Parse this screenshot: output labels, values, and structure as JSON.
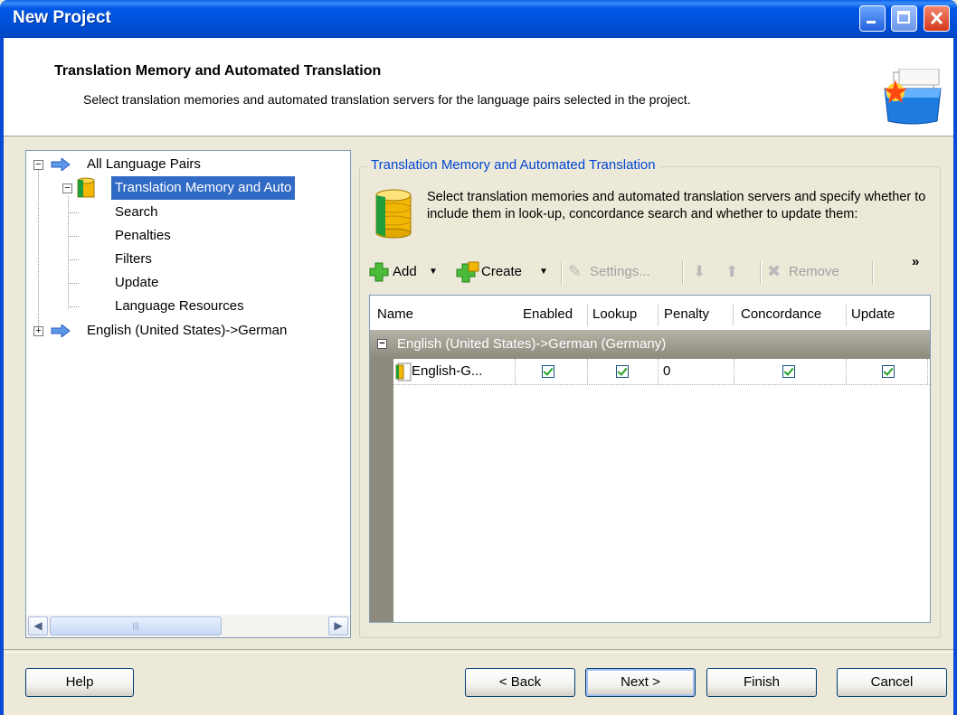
{
  "window": {
    "title": "New Project"
  },
  "header": {
    "title": "Translation Memory and Automated Translation",
    "subtitle": "Select translation memories and automated translation servers for the language pairs selected in the project."
  },
  "tree": {
    "all_language_pairs": "All Language Pairs",
    "selected_item": "Translation Memory and Auto",
    "children": [
      "Search",
      "Penalties",
      "Filters",
      "Update",
      "Language Resources"
    ],
    "language_pair": "English (United States)->German"
  },
  "panel": {
    "group_title": "Translation Memory and Automated Translation",
    "description": "Select translation memories and automated translation servers and specify whether to include them in look-up, concordance search and whether to update them:"
  },
  "toolbar": {
    "add": "Add",
    "create": "Create",
    "settings": "Settings...",
    "remove": "Remove",
    "overflow": "»"
  },
  "grid": {
    "columns": [
      "Name",
      "Enabled",
      "Lookup",
      "Penalty",
      "Concordance",
      "Update"
    ],
    "group_label": "English (United States)->German (Germany)",
    "rows": [
      {
        "name": "English-G...",
        "enabled": true,
        "lookup": true,
        "penalty": "0",
        "concordance": true,
        "update": true
      }
    ]
  },
  "buttons": {
    "help": "Help",
    "back": "< Back",
    "next": "Next >",
    "finish": "Finish",
    "cancel": "Cancel"
  }
}
